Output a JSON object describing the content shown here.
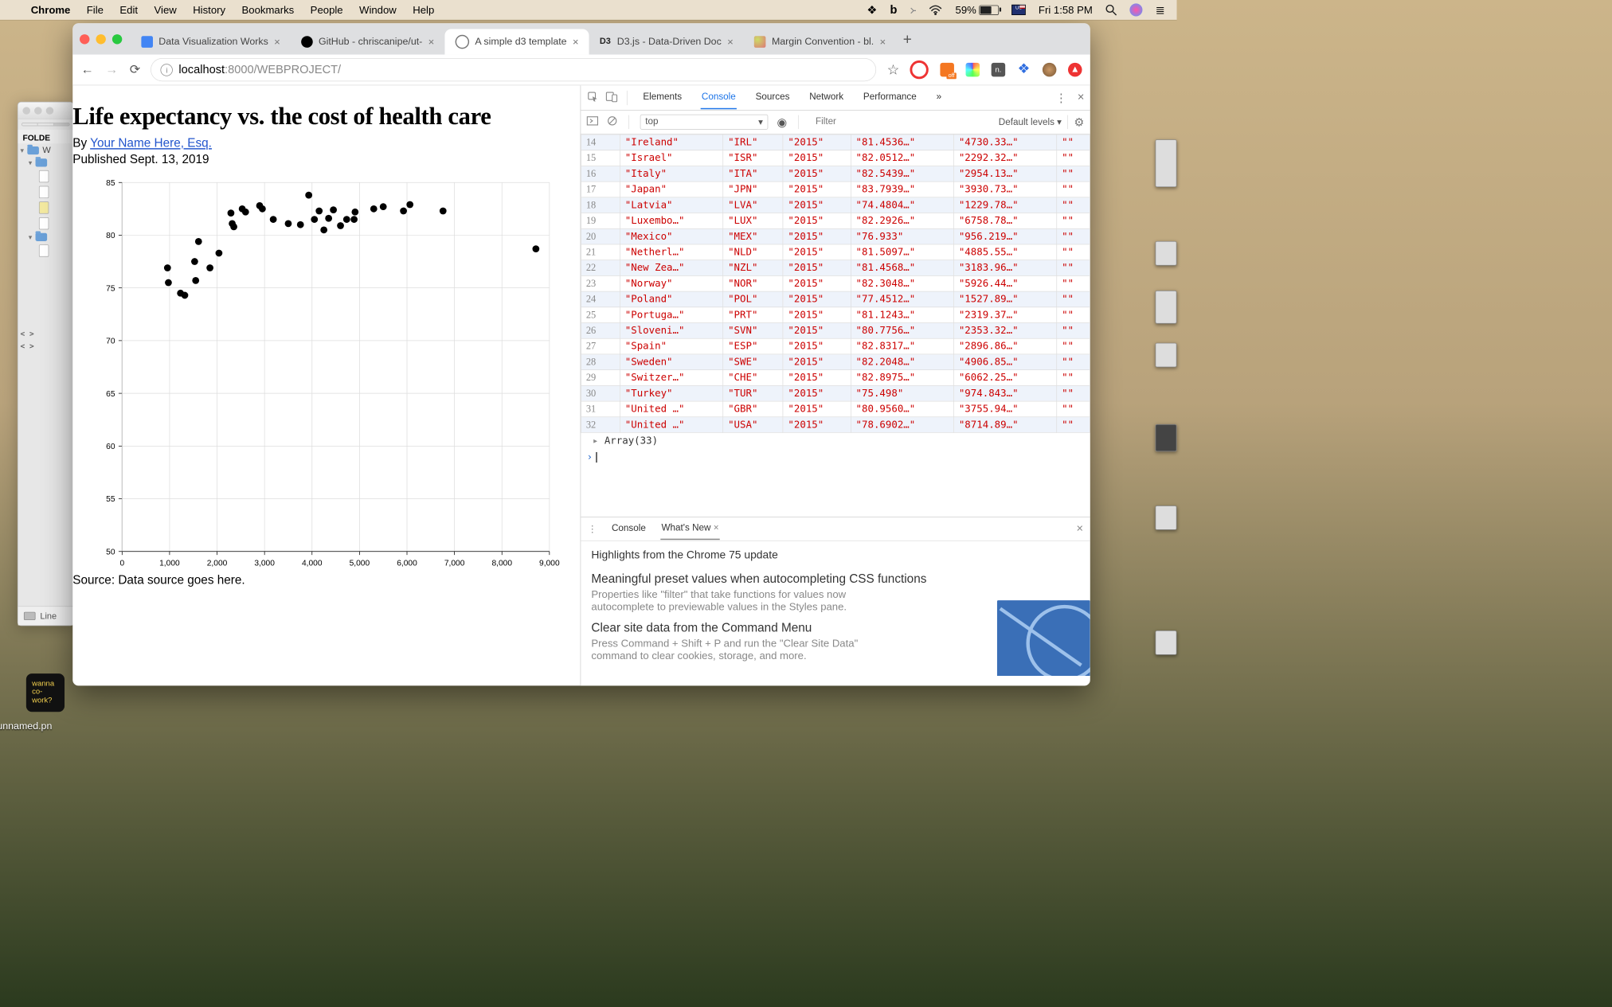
{
  "menubar": {
    "app": "Chrome",
    "items": [
      "File",
      "Edit",
      "View",
      "History",
      "Bookmarks",
      "People",
      "Window",
      "Help"
    ],
    "battery": "59%",
    "clock": "Fri 1:58 PM"
  },
  "bg_window": {
    "segments": [
      "",
      "",
      ""
    ],
    "folders_header": "FOLDE",
    "rows": [
      "W",
      "",
      "",
      "",
      "",
      "",
      "",
      "",
      ""
    ],
    "footer": "Line"
  },
  "tabs": [
    {
      "title": "Data Visualization Works",
      "icon": "#4285f4"
    },
    {
      "title": "GitHub - chriscanipe/ut-",
      "icon": "#000"
    },
    {
      "title": "A simple d3 template",
      "icon": "#555",
      "active": true
    },
    {
      "title": "D3.js - Data-Driven Doc",
      "icon": "#333"
    },
    {
      "title": "Margin Convention - bl.",
      "icon": "#d86"
    }
  ],
  "address": {
    "prefix": "localhost",
    "port_path": ":8000/WEBPROJECT/"
  },
  "page": {
    "h1": "Life expectancy vs. the cost of health care",
    "byline_pre": "By ",
    "byline_link": "Your Name Here, Esq.",
    "published": "Published Sept. 13, 2019",
    "source": "Source: Data source goes here."
  },
  "chart_data": {
    "type": "scatter",
    "xlabel": "",
    "ylabel": "",
    "xlim": [
      0,
      9000
    ],
    "ylim": [
      50,
      85
    ],
    "xticks": [
      0,
      1000,
      2000,
      3000,
      4000,
      5000,
      6000,
      7000,
      8000,
      9000
    ],
    "xtick_labels": [
      "0",
      "1,000",
      "2,000",
      "3,000",
      "4,000",
      "5,000",
      "6,000",
      "7,000",
      "8,000",
      "9,000"
    ],
    "yticks": [
      50,
      55,
      60,
      65,
      70,
      75,
      80,
      85
    ],
    "points": [
      {
        "x": 956,
        "y": 76.9
      },
      {
        "x": 975,
        "y": 75.5
      },
      {
        "x": 1230,
        "y": 74.5
      },
      {
        "x": 1320,
        "y": 74.3
      },
      {
        "x": 1528,
        "y": 77.5
      },
      {
        "x": 1550,
        "y": 75.7
      },
      {
        "x": 1610,
        "y": 79.4
      },
      {
        "x": 1850,
        "y": 76.9
      },
      {
        "x": 2040,
        "y": 78.3
      },
      {
        "x": 2292,
        "y": 82.1
      },
      {
        "x": 2319,
        "y": 81.1
      },
      {
        "x": 2353,
        "y": 80.8
      },
      {
        "x": 2530,
        "y": 82.5
      },
      {
        "x": 2600,
        "y": 82.2
      },
      {
        "x": 2897,
        "y": 82.8
      },
      {
        "x": 2954,
        "y": 82.5
      },
      {
        "x": 3184,
        "y": 81.5
      },
      {
        "x": 3500,
        "y": 81.1
      },
      {
        "x": 3756,
        "y": 81.0
      },
      {
        "x": 3931,
        "y": 83.8
      },
      {
        "x": 4050,
        "y": 81.5
      },
      {
        "x": 4150,
        "y": 82.3
      },
      {
        "x": 4250,
        "y": 80.5
      },
      {
        "x": 4350,
        "y": 81.6
      },
      {
        "x": 4450,
        "y": 82.4
      },
      {
        "x": 4600,
        "y": 80.9
      },
      {
        "x": 4730,
        "y": 81.5
      },
      {
        "x": 4886,
        "y": 81.5
      },
      {
        "x": 4907,
        "y": 82.2
      },
      {
        "x": 5300,
        "y": 82.5
      },
      {
        "x": 5500,
        "y": 82.7
      },
      {
        "x": 5926,
        "y": 82.3
      },
      {
        "x": 6062,
        "y": 82.9
      },
      {
        "x": 6759,
        "y": 82.3
      },
      {
        "x": 8715,
        "y": 78.7
      }
    ]
  },
  "devtools": {
    "panels": [
      "Elements",
      "Console",
      "Sources",
      "Network",
      "Performance"
    ],
    "active_panel": "Console",
    "context": "top",
    "filter_placeholder": "Filter",
    "levels": "Default levels",
    "array_label": "Array(33)",
    "rows": [
      {
        "i": 14,
        "c": "Ireland",
        "cc": "IRL",
        "y": "2015",
        "a": "81.4536…",
        "b": "4730.33…",
        "e": ""
      },
      {
        "i": 15,
        "c": "Israel",
        "cc": "ISR",
        "y": "2015",
        "a": "82.0512…",
        "b": "2292.32…",
        "e": ""
      },
      {
        "i": 16,
        "c": "Italy",
        "cc": "ITA",
        "y": "2015",
        "a": "82.5439…",
        "b": "2954.13…",
        "e": ""
      },
      {
        "i": 17,
        "c": "Japan",
        "cc": "JPN",
        "y": "2015",
        "a": "83.7939…",
        "b": "3930.73…",
        "e": ""
      },
      {
        "i": 18,
        "c": "Latvia",
        "cc": "LVA",
        "y": "2015",
        "a": "74.4804…",
        "b": "1229.78…",
        "e": ""
      },
      {
        "i": 19,
        "c": "Luxembo…",
        "cc": "LUX",
        "y": "2015",
        "a": "82.2926…",
        "b": "6758.78…",
        "e": ""
      },
      {
        "i": 20,
        "c": "Mexico",
        "cc": "MEX",
        "y": "2015",
        "a": "76.933",
        "b": "956.219…",
        "e": ""
      },
      {
        "i": 21,
        "c": "Netherl…",
        "cc": "NLD",
        "y": "2015",
        "a": "81.5097…",
        "b": "4885.55…",
        "e": ""
      },
      {
        "i": 22,
        "c": "New Zea…",
        "cc": "NZL",
        "y": "2015",
        "a": "81.4568…",
        "b": "3183.96…",
        "e": ""
      },
      {
        "i": 23,
        "c": "Norway",
        "cc": "NOR",
        "y": "2015",
        "a": "82.3048…",
        "b": "5926.44…",
        "e": ""
      },
      {
        "i": 24,
        "c": "Poland",
        "cc": "POL",
        "y": "2015",
        "a": "77.4512…",
        "b": "1527.89…",
        "e": ""
      },
      {
        "i": 25,
        "c": "Portuga…",
        "cc": "PRT",
        "y": "2015",
        "a": "81.1243…",
        "b": "2319.37…",
        "e": ""
      },
      {
        "i": 26,
        "c": "Sloveni…",
        "cc": "SVN",
        "y": "2015",
        "a": "80.7756…",
        "b": "2353.32…",
        "e": ""
      },
      {
        "i": 27,
        "c": "Spain",
        "cc": "ESP",
        "y": "2015",
        "a": "82.8317…",
        "b": "2896.86…",
        "e": ""
      },
      {
        "i": 28,
        "c": "Sweden",
        "cc": "SWE",
        "y": "2015",
        "a": "82.2048…",
        "b": "4906.85…",
        "e": ""
      },
      {
        "i": 29,
        "c": "Switzer…",
        "cc": "CHE",
        "y": "2015",
        "a": "82.8975…",
        "b": "6062.25…",
        "e": ""
      },
      {
        "i": 30,
        "c": "Turkey",
        "cc": "TUR",
        "y": "2015",
        "a": "75.498",
        "b": "974.843…",
        "e": ""
      },
      {
        "i": 31,
        "c": "United …",
        "cc": "GBR",
        "y": "2015",
        "a": "80.9560…",
        "b": "3755.94…",
        "e": ""
      },
      {
        "i": 32,
        "c": "United …",
        "cc": "USA",
        "y": "2015",
        "a": "78.6902…",
        "b": "8714.89…",
        "e": ""
      }
    ],
    "drawer": {
      "tabs": [
        "Console",
        "What's New"
      ],
      "active": "What's New",
      "highlights": "Highlights from the Chrome 75 update",
      "h1": "Meaningful preset values when autocompleting CSS functions",
      "p1": "Properties like \"filter\" that take functions for values now autocomplete to previewable values in the Styles pane.",
      "h2": "Clear site data from the Command Menu",
      "p2": "Press Command + Shift + P and run the \"Clear Site Data\" command to clear cookies, storage, and more."
    }
  },
  "dock_label": "wanna\nco-work?",
  "desktop_file": "unnamed.pn"
}
